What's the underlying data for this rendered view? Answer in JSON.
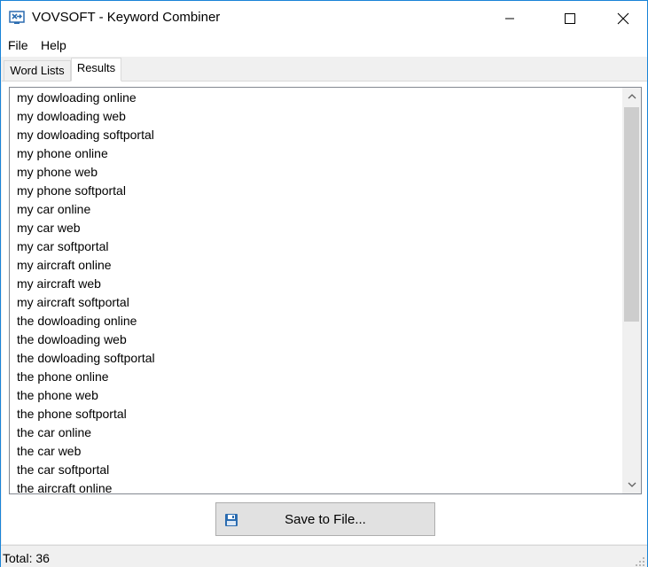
{
  "window": {
    "title": "VOVSOFT - Keyword Combiner"
  },
  "menu": {
    "file": "File",
    "help": "Help"
  },
  "tabs": [
    {
      "label": "Word Lists",
      "active": false
    },
    {
      "label": "Results",
      "active": true
    }
  ],
  "results": {
    "items": [
      "my dowloading online",
      "my dowloading web",
      "my dowloading softportal",
      "my phone online",
      "my phone web",
      "my phone softportal",
      "my car online",
      "my car web",
      "my car softportal",
      "my aircraft online",
      "my aircraft web",
      "my aircraft softportal",
      "the dowloading online",
      "the dowloading web",
      "the dowloading softportal",
      "the phone online",
      "the phone web",
      "the phone softportal",
      "the car online",
      "the car web",
      "the car softportal",
      "the aircraft online"
    ]
  },
  "save_button": {
    "label": "Save to File...",
    "icon": "floppy-disk-icon"
  },
  "status": {
    "text": "Total: 36"
  },
  "colors": {
    "window_border": "#1883d7",
    "chrome_bg": "#f0f0f0",
    "button_bg": "#e1e1e1",
    "scroll_thumb": "#cdcdcd",
    "icon_blue": "#2b6cb0"
  }
}
